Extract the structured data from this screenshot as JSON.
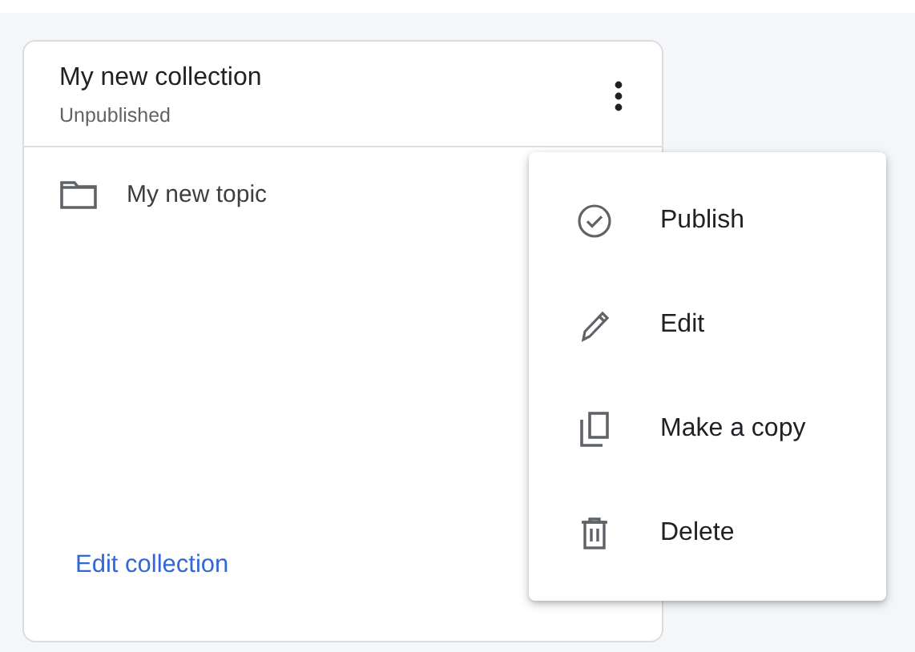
{
  "card": {
    "title": "My new collection",
    "status": "Unpublished",
    "topics": [
      {
        "label": "My new topic"
      }
    ],
    "link": "Edit collection"
  },
  "menu": {
    "items": [
      {
        "kind": "publish",
        "label": "Publish"
      },
      {
        "kind": "edit",
        "label": "Edit"
      },
      {
        "kind": "copy",
        "label": "Make a copy"
      },
      {
        "kind": "delete",
        "label": "Delete"
      }
    ]
  }
}
